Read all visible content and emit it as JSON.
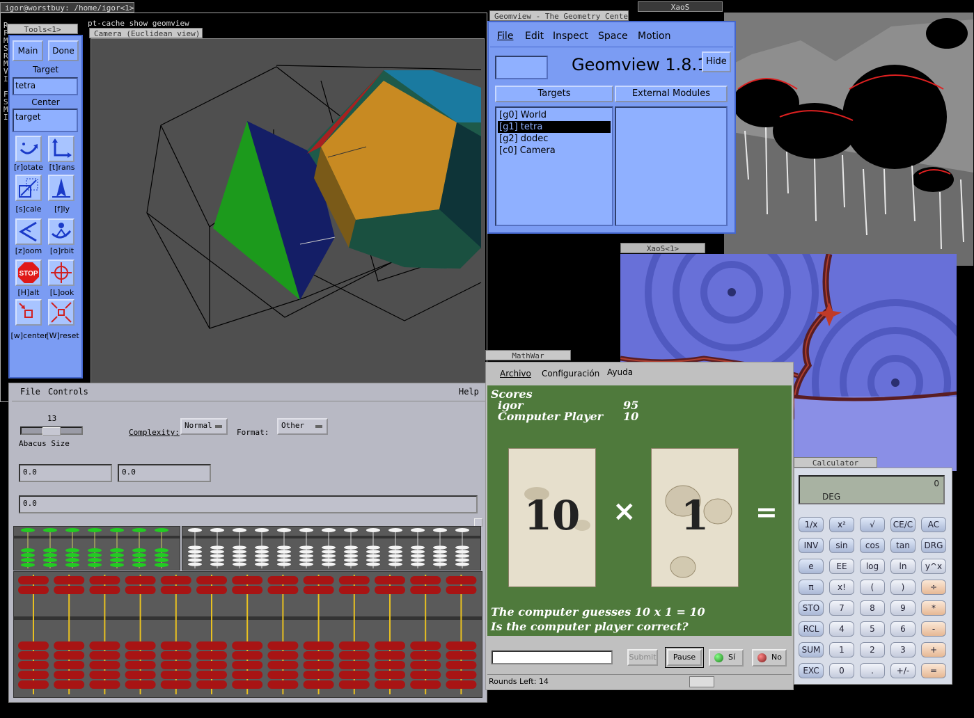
{
  "terminal": {
    "title": "igor@worstbuy: /home/igor<1>",
    "command_fragment": "pt-cache show  geomview",
    "left_chars": [
      "R",
      "F",
      "M",
      "S",
      "R",
      "M",
      "V",
      "I",
      "",
      "F",
      "S",
      "M",
      "I"
    ]
  },
  "tools": {
    "title": "Tools<1>",
    "main_label": "Main",
    "done_label": "Done",
    "target_label": "Target",
    "target_value": "tetra",
    "center_label": "Center",
    "center_value": "target",
    "icons": [
      {
        "name": "rotate",
        "caption": "[r]otate"
      },
      {
        "name": "translate",
        "caption": "[t]rans"
      },
      {
        "name": "scale",
        "caption": "[s]cale"
      },
      {
        "name": "fly",
        "caption": "[f]ly"
      },
      {
        "name": "zoom",
        "caption": "[z]oom"
      },
      {
        "name": "orbit",
        "caption": "[o]rbit"
      },
      {
        "name": "halt",
        "caption": "[H]alt"
      },
      {
        "name": "look",
        "caption": "[L]ook"
      },
      {
        "name": "center",
        "caption": "[w]center"
      },
      {
        "name": "reset",
        "caption": "[W]reset"
      }
    ]
  },
  "camera": {
    "title": "Camera (Euclidean view)"
  },
  "abacus": {
    "menu": {
      "file": "File",
      "controls": "Controls",
      "help": "Help"
    },
    "size_value": "13",
    "size_label": "Abacus Size",
    "complexity_label": "Complexity:",
    "complexity_value": "Normal",
    "format_label": "Format:",
    "format_value": "Other",
    "field1": "0.0",
    "field2": "0.0",
    "field3": "0.0"
  },
  "geomview": {
    "title": "Geomview - The Geometry Center",
    "menu": [
      "File",
      "Edit",
      "Inspect",
      "Space",
      "Motion"
    ],
    "app_title": "Geomview 1.8.1",
    "hide_label": "Hide",
    "targets_label": "Targets",
    "modules_label": "External Modules",
    "targets": [
      "[g0] World",
      "[g1] tetra",
      "[g2] dodec",
      "[c0] Camera"
    ],
    "selected_index": 1
  },
  "xaos1": {
    "title": "XaoS"
  },
  "xaos2": {
    "title": "XaoS<1>"
  },
  "mathwar": {
    "title": "MathWar",
    "menu": [
      "Archivo",
      "Configuración",
      "Ayuda"
    ],
    "scores_heading": "Scores",
    "player1_name": "igor",
    "player1_score": "95",
    "player2_name": "Computer Player",
    "player2_score": "10",
    "card1": "10",
    "operator": "×",
    "card2": "1",
    "equals": "=",
    "message1": "The computer guesses 10 x 1 = 10",
    "message2": "Is the computer player correct?",
    "submit_label": "Submit",
    "pause_label": "Pause",
    "yes_label": "Sí",
    "no_label": "No",
    "rounds_label": "Rounds Left: 14"
  },
  "calculator": {
    "title": "Calculator",
    "display_value": "0",
    "display_mode": "DEG",
    "keys": [
      [
        "1/x",
        "x²",
        "√",
        "CE/C",
        "AC"
      ],
      [
        "INV",
        "sin",
        "cos",
        "tan",
        "DRG"
      ],
      [
        "e",
        "EE",
        "log",
        "ln",
        "y^x"
      ],
      [
        "π",
        "x!",
        "(",
        ")",
        "÷"
      ],
      [
        "STO",
        "7",
        "8",
        "9",
        "*"
      ],
      [
        "RCL",
        "4",
        "5",
        "6",
        "-"
      ],
      [
        "SUM",
        "1",
        "2",
        "3",
        "+"
      ],
      [
        "EXC",
        "0",
        ".",
        "+/-",
        "="
      ]
    ]
  },
  "colors": {
    "geomview_blue": "#7b9cf3",
    "abacus_bead_red": "#a81414",
    "mathwar_felt": "#4f7a3c"
  }
}
